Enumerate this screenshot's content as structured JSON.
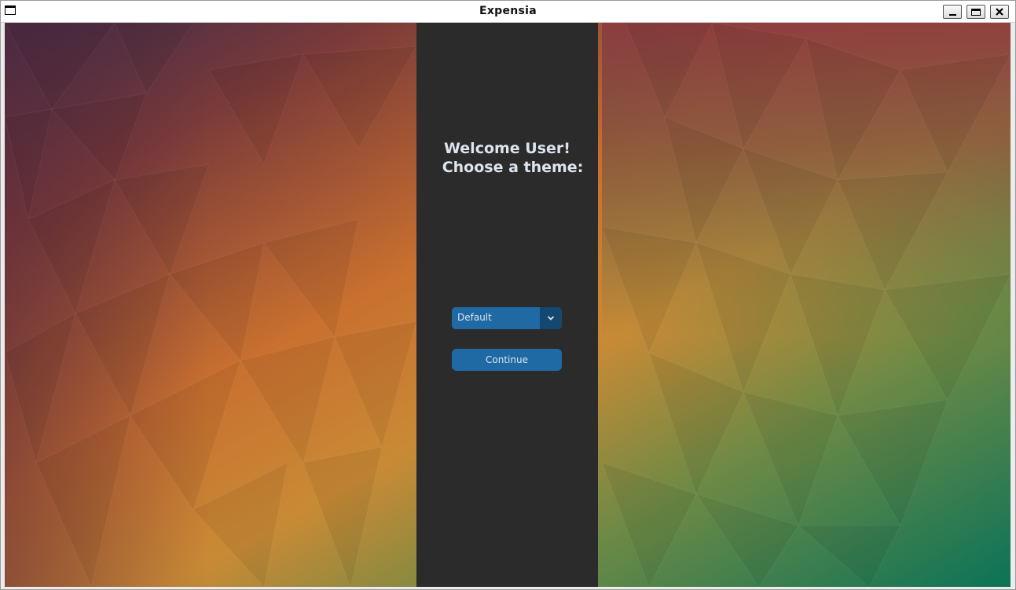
{
  "window": {
    "title": "Expensia",
    "icon": "window-icon"
  },
  "titlebar_buttons": {
    "minimize_icon": "minimize-icon",
    "maximize_icon": "maximize-icon",
    "close_icon": "close-icon"
  },
  "welcome": {
    "line1": "Welcome User!",
    "line2": "Choose a theme:"
  },
  "theme_select": {
    "value": "Default",
    "icon": "chevron-down-icon"
  },
  "continue_button": {
    "label": "Continue"
  },
  "colors": {
    "panel": "#2b2b2b",
    "accent": "#1f6aa5",
    "accent_dark": "#144870",
    "text": "#dce4ee"
  }
}
